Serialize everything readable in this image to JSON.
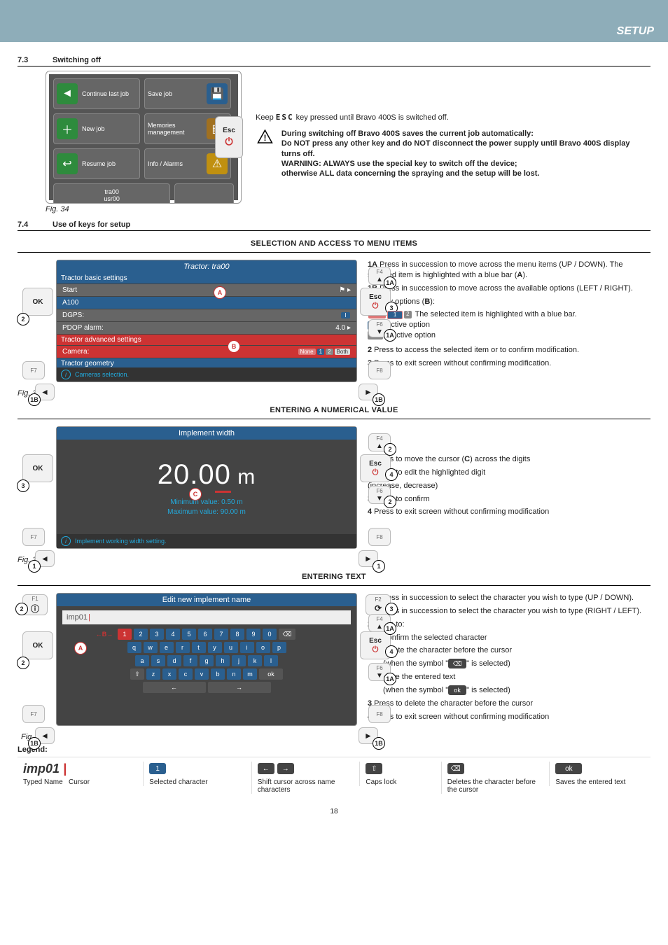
{
  "header": {
    "chapter": "SETUP"
  },
  "sec73": {
    "num": "7.3",
    "title": "Switching off",
    "fig": "Fig. 34",
    "tiles": {
      "continue": "Continue last job",
      "save": "Save job",
      "new": "New job",
      "memories": "Memories management",
      "resume": "Resume job",
      "info": "Info / Alarms",
      "tra": "tra00",
      "usr": "usr00"
    },
    "esc": "Esc",
    "keep_pre": "Keep ",
    "esc_inline": "ESC",
    "keep_post": " key pressed until Bravo 400S is switched off.",
    "warn1": "During switching off Bravo 400S saves the current job automatically:",
    "warn2": "Do NOT press any other key and do NOT disconnect the power supply until Bravo 400S display turns off.",
    "warn3": "WARNING: ALWAYS use the special key to switch off the device;",
    "warn4": "otherwise ALL data concerning the spraying and the setup will be lost."
  },
  "sec74": {
    "num": "7.4",
    "title": "Use of keys for setup"
  },
  "block1": {
    "title": "SELECTION AND ACCESS TO MENU ITEMS",
    "fig": "Fig. 35",
    "scr": {
      "title": "Tractor: tra00",
      "group1": "Tractor basic settings",
      "r_start_l": "Start",
      "r_start_r": "⚑ ▸",
      "r_a100_l": "A100",
      "r_a100_r": "",
      "r_dgps_l": "DGPS:",
      "r_dgps_r": "",
      "r_pdop_l": "PDOP alarm:",
      "r_pdop_r": "4.0  ▸",
      "group2": "Tractor advanced settings",
      "r_cam_l": "Camera:",
      "r_cam_r_none": "None",
      "r_cam_r_1": "1",
      "r_cam_r_2": "2",
      "r_cam_r_both": "Both",
      "group3": "Tractor geometry",
      "hint": "Cameras selection."
    },
    "btns": {
      "ok": "OK",
      "esc": "Esc",
      "f4": "F4",
      "f6": "F6",
      "f7": "F7",
      "f8": "F8"
    },
    "desc": {
      "l1a_b": "1A",
      "l1a": " Press in succession to move across the menu items (UP / DOWN). The selected item is highlighted with a blue bar (",
      "l1a_end": ").",
      "l1b_b": "1B",
      "l1b": " Press in succession to move across the available options (LEFT / RIGHT).",
      "disp": "Display options (",
      "disp_b": "B",
      "disp_end": "):",
      "opt_sel": " The selected item is highlighted with a blue bar.",
      "opt_act": "Active option",
      "opt_inact": "Inactive option",
      "l2_b": "2",
      "l2": " Press to access the selected item or to confirm modification.",
      "l3_b": "3",
      "l3": " Press to exit screen without confirming modification."
    }
  },
  "block2": {
    "title": "ENTERING A NUMERICAL VALUE",
    "fig": "Fig. 36",
    "scr": {
      "title": "Implement width",
      "value_pre": "20.0",
      "value_cursor": "0",
      "unit": " m",
      "min": "Minimum value:  0.50 m",
      "max": "Maximum value:  90.00 m",
      "hint": "Implement working width setting."
    },
    "desc": {
      "l1_b": "1",
      "l1": " Press to move the cursor (",
      "l1_c": "C",
      "l1_end": ") across the digits",
      "l2_b": "2",
      "l2": " Press to edit the highlighted digit",
      "l2a": "(increase, decrease)",
      "l3_b": "3",
      "l3": " Press to confirm",
      "l4_b": "4",
      "l4": " Press to exit screen without confirming modification"
    }
  },
  "block3": {
    "title": "ENTERING TEXT",
    "fig": "Fig. 37",
    "scr": {
      "title": "Edit new implement name",
      "typed": "imp01",
      "row1": [
        "1",
        "2",
        "3",
        "4",
        "5",
        "6",
        "7",
        "8",
        "9",
        "0",
        "⌫"
      ],
      "row2": [
        "q",
        "w",
        "e",
        "r",
        "t",
        "y",
        "u",
        "i",
        "o",
        "p"
      ],
      "row3": [
        "a",
        "s",
        "d",
        "f",
        "g",
        "h",
        "j",
        "k",
        "l"
      ],
      "row4_shift": "⇧",
      "row4": [
        "z",
        "x",
        "c",
        "v",
        "b",
        "n",
        "m"
      ],
      "row4_ok": "ok",
      "row5_l": "←",
      "row5_r": "→"
    },
    "btns": {
      "f1": "F1",
      "f2": "F2"
    },
    "desc": {
      "l1a_b": "1A",
      "l1a": " Press in succession to select the character you wish to type (UP / DOWN).",
      "l1b_b": "1B",
      "l1b": " Press in succession to select the character you wish to type (RIGHT / LEFT).",
      "l2_b": "2",
      "l2": " Press to:",
      "l2a": "- Confirm the selected character",
      "l2b": "- Delete the character before the cursor",
      "l2b_when_pre": "(when the symbol \"",
      "l2b_when_post": "\" is selected)",
      "l2c": "- Save the entered text",
      "l2c_when_pre": "(when the symbol \"",
      "l2c_sym": "ok",
      "l2c_when_post": "\" is selected)",
      "l3_b": "3",
      "l3": " Press to delete the character before the cursor",
      "l4_b": "4",
      "l4": " Press to exit screen without confirming modification"
    },
    "legend": {
      "label": "Legend:",
      "typed_name": "imp01",
      "typed_label": "Typed Name",
      "cursor_label": "Cursor",
      "sel_char": "1",
      "sel_label": "Selected character",
      "shift_l": "←",
      "shift_r": "→",
      "shift_label": "Shift cursor across name characters",
      "caps": "⇧",
      "caps_label": "Caps lock",
      "bksp": "⌫",
      "bksp_label": "Deletes the character before the cursor",
      "ok": "ok",
      "ok_label": "Saves the entered text"
    }
  },
  "page_num": "18"
}
